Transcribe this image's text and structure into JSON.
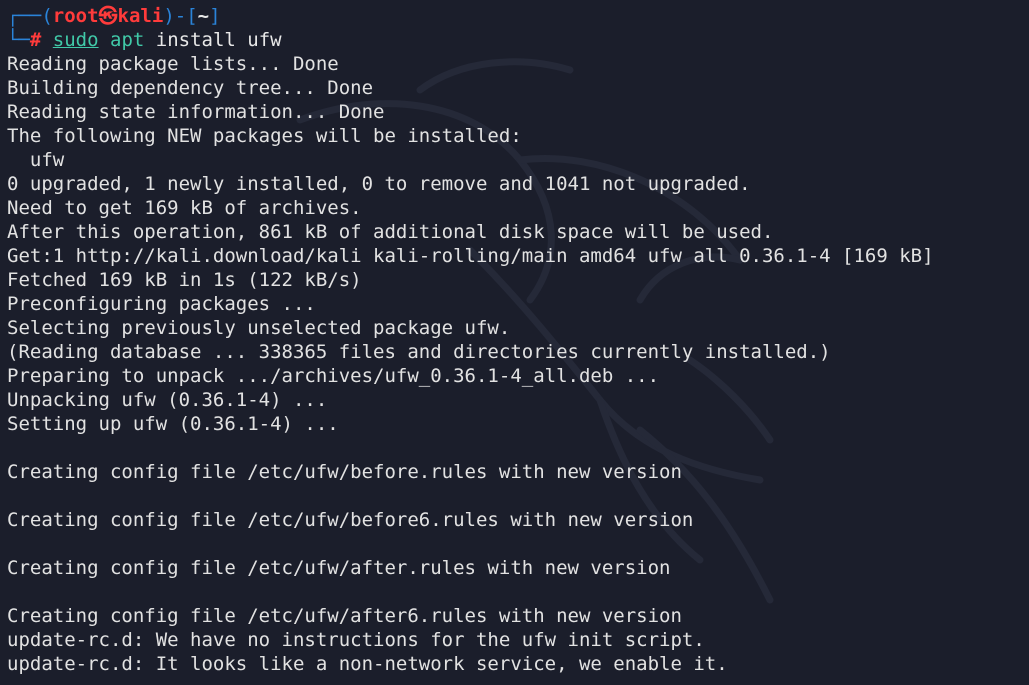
{
  "prompt": {
    "corner_top": "┌──(",
    "user": "root",
    "separator_icon": "㉿",
    "host": "kali",
    "close_open": ")-[",
    "cwd": "~",
    "close": "]",
    "corner_bottom": "└─",
    "hash": "#",
    "cmd_sudo": "sudo",
    "cmd_apt": "apt",
    "cmd_args": "install ufw"
  },
  "output": [
    "Reading package lists... Done",
    "Building dependency tree... Done",
    "Reading state information... Done",
    "The following NEW packages will be installed:",
    "  ufw",
    "0 upgraded, 1 newly installed, 0 to remove and 1041 not upgraded.",
    "Need to get 169 kB of archives.",
    "After this operation, 861 kB of additional disk space will be used.",
    "Get:1 http://kali.download/kali kali-rolling/main amd64 ufw all 0.36.1-4 [169 kB]",
    "Fetched 169 kB in 1s (122 kB/s)",
    "Preconfiguring packages ...",
    "Selecting previously unselected package ufw.",
    "(Reading database ... 338365 files and directories currently installed.)",
    "Preparing to unpack .../archives/ufw_0.36.1-4_all.deb ...",
    "Unpacking ufw (0.36.1-4) ...",
    "Setting up ufw (0.36.1-4) ...",
    "",
    "Creating config file /etc/ufw/before.rules with new version",
    "",
    "Creating config file /etc/ufw/before6.rules with new version",
    "",
    "Creating config file /etc/ufw/after.rules with new version",
    "",
    "Creating config file /etc/ufw/after6.rules with new version",
    "update-rc.d: We have no instructions for the ufw init script.",
    "update-rc.d: It looks like a non-network service, we enable it."
  ],
  "colors": {
    "background": "#1b1e2b",
    "prompt_frame": "#2a83d8",
    "prompt_user": "#ff3b3b",
    "command": "#41c9a8",
    "text": "#e2e2e2"
  },
  "icons": {
    "background": "kali-dragon-watermark-icon"
  }
}
